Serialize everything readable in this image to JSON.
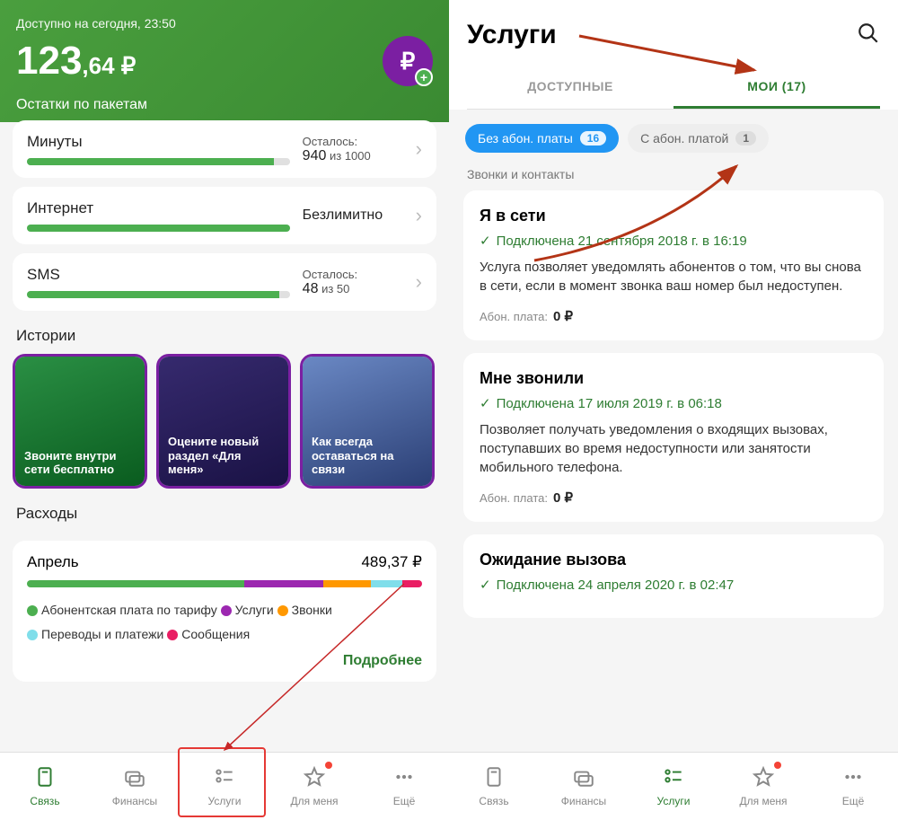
{
  "left": {
    "avail_label": "Доступно на сегодня, 23:50",
    "balance_major": "123",
    "balance_minor": ",64 ₽",
    "rub_symbol": "₽",
    "remain_title": "Остатки по пакетам",
    "packages": [
      {
        "name": "Минуты",
        "left_label": "Осталось:",
        "value": "940",
        "of": "из 1000",
        "pct": 94
      },
      {
        "name": "Интернет",
        "left_label": "",
        "value": "Безлимитно",
        "of": "",
        "pct": 100
      },
      {
        "name": "SMS",
        "left_label": "Осталось:",
        "value": "48",
        "of": "из 50",
        "pct": 96
      }
    ],
    "stories_title": "Истории",
    "stories": [
      {
        "text": "Звоните внутри сети бесплатно",
        "bg": "linear-gradient(160deg,#2a8f44 0%,#0a5c1f 100%)"
      },
      {
        "text": "Оцените новый раздел «Для меня»",
        "bg": "linear-gradient(160deg,#362a6e 0%,#1a1245 100%)"
      },
      {
        "text": "Как всегда оставаться на связи",
        "bg": "linear-gradient(160deg,#6a88c4 0%,#2b3f75 100%)"
      }
    ],
    "spend_title": "Расходы",
    "spend_month": "Апрель",
    "spend_amount": "489,37 ₽",
    "legend": [
      {
        "color": "#4caf50",
        "label": "Абонентская плата по тарифу"
      },
      {
        "color": "#9c27b0",
        "label": "Услуги"
      },
      {
        "color": "#ff9800",
        "label": "Звонки"
      },
      {
        "color": "#80deea",
        "label": "Переводы и платежи"
      },
      {
        "color": "#e91e63",
        "label": "Сообщения"
      }
    ],
    "more_label": "Подробнее",
    "tabs": [
      "Связь",
      "Финансы",
      "Услуги",
      "Для меня",
      "Ещё"
    ]
  },
  "right": {
    "title": "Услуги",
    "tabs": {
      "available": "ДОСТУПНЫЕ",
      "my": "МОИ (17)"
    },
    "pills": {
      "no_fee": "Без абон. платы",
      "no_fee_cnt": "16",
      "fee": "С абон. платой",
      "fee_cnt": "1"
    },
    "group": "Звонки и контакты",
    "services": [
      {
        "name": "Я в сети",
        "connected": "Подключена 21 сентября 2018 г. в 16:19",
        "desc": "Услуга позволяет уведомлять абонентов о том, что вы снова в сети, если в момент звонка ваш номер был недоступен.",
        "fee_label": "Абон. плата:",
        "fee": "0 ₽"
      },
      {
        "name": "Мне звонили",
        "connected": "Подключена 17 июля 2019 г. в 06:18",
        "desc": "Позволяет получать уведомления о входящих вызовах, поступавших во время недоступности или занятости мобильного телефона.",
        "fee_label": "Абон. плата:",
        "fee": "0 ₽"
      },
      {
        "name": "Ожидание вызова",
        "connected": "Подключена 24 апреля 2020 г. в 02:47",
        "desc": "",
        "fee_label": "",
        "fee": ""
      }
    ],
    "tabs_bottom": [
      "Связь",
      "Финансы",
      "Услуги",
      "Для меня",
      "Ещё"
    ]
  }
}
